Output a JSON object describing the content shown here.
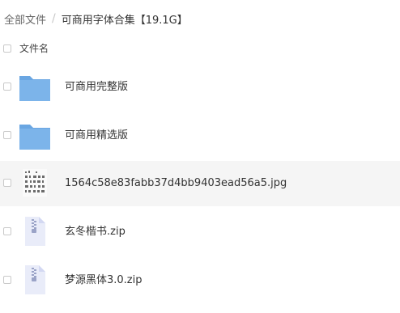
{
  "breadcrumb": {
    "root": "全部文件",
    "separator": "/",
    "current": "可商用字体合集【19.1G】"
  },
  "list_header": {
    "name_label": "文件名"
  },
  "files": [
    {
      "name": "可商用完整版",
      "type": "folder"
    },
    {
      "name": "可商用精选版",
      "type": "folder"
    },
    {
      "name": "1564c58e83fabb37d4bb9403ead56a5.jpg",
      "type": "image",
      "highlighted": true
    },
    {
      "name": "玄冬楷书.zip",
      "type": "zip"
    },
    {
      "name": "梦源黑体3.0.zip",
      "type": "zip"
    }
  ],
  "colors": {
    "folder": "#7cb4ea",
    "folder_tab": "#6aa6e2",
    "zip": "#e9ecf9",
    "row_highlight": "#f5f5f5"
  }
}
